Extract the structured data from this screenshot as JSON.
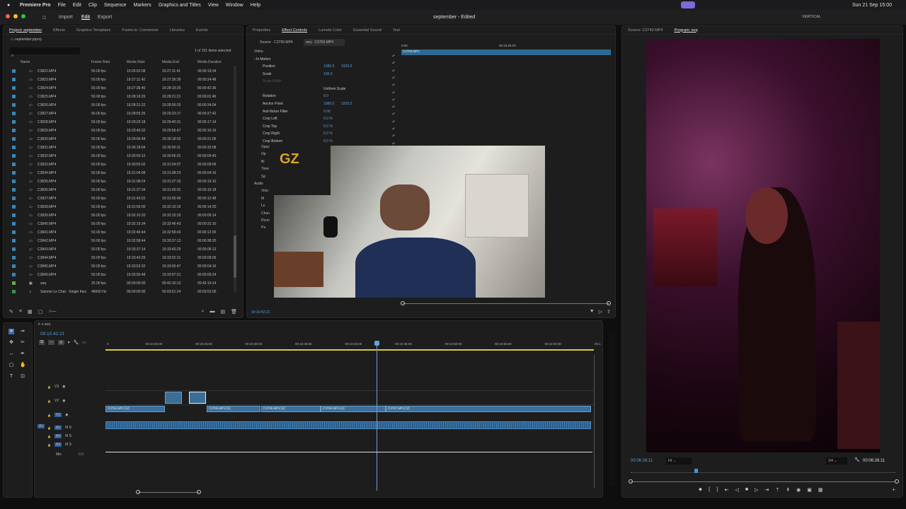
{
  "menubar": {
    "apple": "",
    "app": "Premiere Pro",
    "items": [
      "File",
      "Edit",
      "Clip",
      "Sequence",
      "Markers",
      "Graphics and Titles",
      "View",
      "Window",
      "Help"
    ],
    "vertical_label": "VERTICAL",
    "clock": "Sun 21 Sep  15:00"
  },
  "appbar": {
    "nav": [
      "Import",
      "Edit",
      "Export"
    ],
    "title": "september - Edited"
  },
  "project": {
    "tabs": [
      "Project: september",
      "Effects",
      "Graphics Templates",
      "Frame.io: Comments",
      "Libraries",
      "Events"
    ],
    "file": "september.prproj",
    "selected": "1 of 101 items selected",
    "cols": [
      "Name",
      "Frame Rate",
      "Media Start",
      "Media End",
      "Media Duration"
    ],
    "rows": [
      [
        "C3822.MP4",
        "50.00 fps",
        "19:26:52:08",
        "19:27:11:41",
        "00:00:19:34"
      ],
      [
        "C3823.MP4",
        "50.00 fps",
        "19:27:11:42",
        "19:27:36:39",
        "00:00:24:48"
      ],
      [
        "C3824.MP4",
        "50.00 fps",
        "19:27:36:40",
        "19:28:19:25",
        "00:00:42:36"
      ],
      [
        "C3825.MP4",
        "50.00 fps",
        "19:28:19:26",
        "19:28:21:21",
        "00:00:01:46"
      ],
      [
        "C3826.MP4",
        "50.00 fps",
        "19:28:21:22",
        "19:28:55:25",
        "00:00:34:04"
      ],
      [
        "C3827.MP4",
        "50.00 fps",
        "19:28:55:26",
        "19:29:23:17",
        "00:00:27:42"
      ],
      [
        "C3828.MP4",
        "50.00 fps",
        "19:29:23:18",
        "19:29:40:31",
        "00:00:17:14"
      ],
      [
        "C3829.MP4",
        "50.00 fps",
        "19:29:40:32",
        "19:29:56:47",
        "00:00:16:16"
      ],
      [
        "C3830.MP4",
        "50.00 fps",
        "19:29:56:48",
        "19:30:18:03",
        "00:00:21:06"
      ],
      [
        "C3831.MP4",
        "50.00 fps",
        "19:30:18:04",
        "19:30:50:11",
        "00:00:32:08"
      ],
      [
        "C3832.MP4",
        "50.00 fps",
        "19:30:50:12",
        "19:30:55:01",
        "00:00:04:40"
      ],
      [
        "C3833.MP4",
        "50.00 fps",
        "19:30:55:02",
        "19:31:04:07",
        "00:00:09:06"
      ],
      [
        "C3834.MP4",
        "50.00 fps",
        "19:31:04:08",
        "19:31:08:23",
        "00:00:04:16"
      ],
      [
        "C3835.MP4",
        "50.00 fps",
        "19:31:08:24",
        "19:31:27:33",
        "00:00:19:10"
      ],
      [
        "C3836.MP4",
        "50.00 fps",
        "19:31:27:34",
        "19:31:43:01",
        "00:00:15:18"
      ],
      [
        "C3837.MP4",
        "50.00 fps",
        "19:31:43:02",
        "19:31:55:49",
        "00:00:12:48"
      ],
      [
        "C3838.MP4",
        "50.00 fps",
        "19:31:56:00",
        "19:32:10:19",
        "00:00:14:20"
      ],
      [
        "C3839.MP4",
        "50.00 fps",
        "19:32:10:20",
        "19:32:15:33",
        "00:00:05:14"
      ],
      [
        "C3840.MP4",
        "50.00 fps",
        "19:32:15:34",
        "19:32:46:43",
        "00:00:31:10"
      ],
      [
        "C3841.MP4",
        "50.00 fps",
        "19:32:46:44",
        "19:32:58:43",
        "00:00:12:00"
      ],
      [
        "C3842.MP4",
        "50.00 fps",
        "19:32:58:44",
        "19:33:37:13",
        "00:00:38:20"
      ],
      [
        "C3843.MP4",
        "50.00 fps",
        "19:33:37:14",
        "19:33:43:25",
        "00:00:06:12"
      ],
      [
        "C3844.MP4",
        "50.00 fps",
        "19:33:43:26",
        "19:33:52:31",
        "00:00:09:06"
      ],
      [
        "C3845.MP4",
        "50.00 fps",
        "19:33:52:32",
        "19:33:56:47",
        "00:00:04:16"
      ],
      [
        "C3846.MP4",
        "50.00 fps",
        "19:33:56:48",
        "19:33:57:21",
        "00:00:00:24"
      ],
      [
        "seq",
        "25.00 fps",
        "00:00:00:00",
        "00:42:10:13",
        "00:42:10:14"
      ],
      [
        "Salomé Le Chat - Single Kiss",
        "48000 Hz",
        "00:00:00:00",
        "00:03:51:24",
        "00:03:52:00"
      ]
    ]
  },
  "effect": {
    "tabs": [
      "Properties",
      "Effect Controls",
      "Lumetri Color",
      "Essential Sound",
      "Text"
    ],
    "source": "Source · C3765.MP4",
    "seq": "seq · C3765.MP4",
    "ruler_start": "0:00",
    "ruler_mark": "00:10:25:00",
    "clip": "C3765.MP4",
    "video": "Video",
    "motion": "Motion",
    "props": [
      {
        "name": "Position",
        "v1": "1080.0",
        "v2": "1920.0"
      },
      {
        "name": "Scale",
        "v1": "100.0",
        "v2": ""
      },
      {
        "name": "Scale Width",
        "v1": "",
        "v2": ""
      },
      {
        "name": "Uniform Scale",
        "v1": "",
        "v2": ""
      },
      {
        "name": "Rotation",
        "v1": "0.0",
        "v2": ""
      },
      {
        "name": "Anchor Point",
        "v1": "1080.0",
        "v2": "1920.0"
      },
      {
        "name": "Anti-flicker Filter",
        "v1": "0.00",
        "v2": ""
      },
      {
        "name": "Crop Left",
        "v1": "0.0 %",
        "v2": ""
      },
      {
        "name": "Crop Top",
        "v1": "0.0 %",
        "v2": ""
      },
      {
        "name": "Crop Right",
        "v1": "0.0 %",
        "v2": ""
      },
      {
        "name": "Crop Bottom",
        "v1": "0.0 %",
        "v2": ""
      }
    ],
    "partial": [
      "Opac",
      "Op",
      "Bl",
      "Time",
      "Sp",
      "Audio",
      "Volu",
      "M",
      "Le",
      "Chan",
      "Penn",
      "Pa"
    ],
    "timecode": "00:10:42:22"
  },
  "program": {
    "tabs": [
      "Source: C3749.MP4",
      "Program: seq"
    ],
    "tc": "00:06:26:11",
    "fit": "Fit",
    "res": "1/4",
    "tc2": "00:06:26:11"
  },
  "timeline": {
    "tab": "seq",
    "tc": "00:10:42:21",
    "ruler": [
      "0",
      "00:10:20:00",
      "00:10:25:00",
      "00:10:30:00",
      "00:10:35:00",
      "00:10:40:00",
      "00:10:45:00",
      "00:10:50:00",
      "00:10:55:00",
      "00:11:00:00",
      "00:1"
    ],
    "tracks": [
      "V3",
      "V2",
      "V1",
      "A1",
      "A2",
      "A3"
    ],
    "a1src": "A1",
    "mix": "Mix",
    "mix_val": "0.0",
    "clips": [
      "C3764.MP4 [V]",
      "C3765.MP4 [V]",
      "C3765.MP4 [V]",
      "C3765.MP4 [V]",
      "C3767.MP4 [V]"
    ]
  },
  "colors": {
    "accent": "#4a8fd6",
    "clipV": "#3b6f9c",
    "clipA": "#254a6e",
    "ruler_yellow": "#d9c94a"
  }
}
